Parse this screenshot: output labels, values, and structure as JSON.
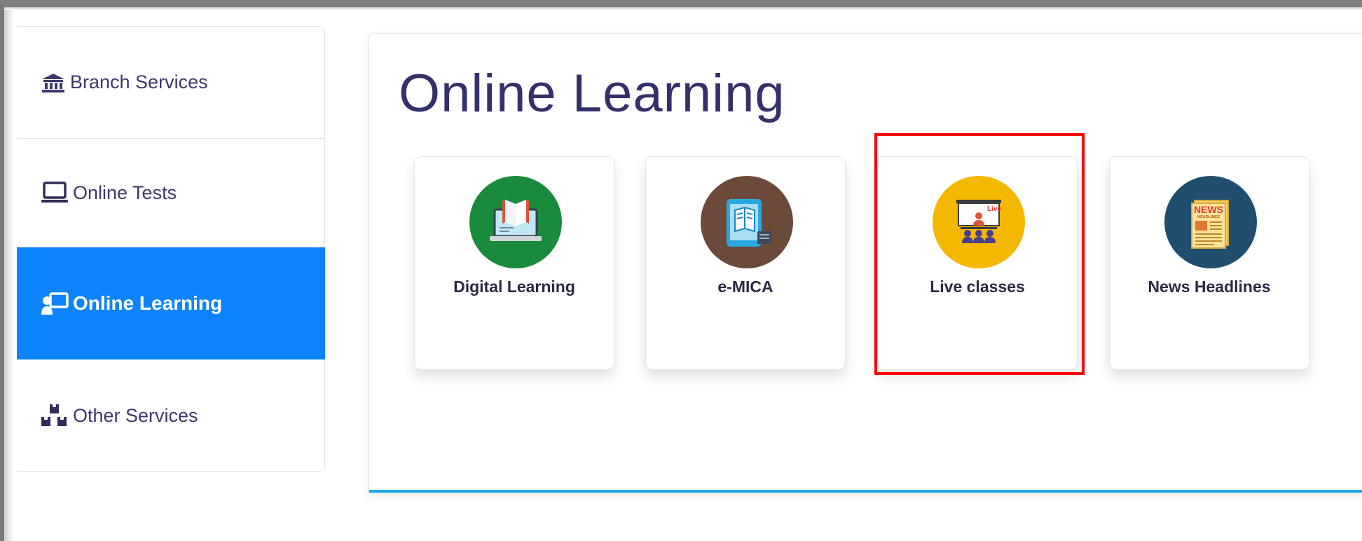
{
  "sidebar": {
    "items": [
      {
        "label": "Branch Services",
        "icon": "bank-icon",
        "active": false
      },
      {
        "label": "Online Tests",
        "icon": "laptop-icon",
        "active": false
      },
      {
        "label": "Online Learning",
        "icon": "teacher-board-icon",
        "active": true
      },
      {
        "label": "Other Services",
        "icon": "boxes-icon",
        "active": false
      }
    ]
  },
  "main": {
    "title": "Online Learning",
    "cards": [
      {
        "label": "Digital Learning",
        "icon": "laptop-book-icon",
        "color": "#1a8a3c"
      },
      {
        "label": "e-MICA",
        "icon": "tablet-book-icon",
        "color": "#6b4a3a"
      },
      {
        "label": "Live classes",
        "icon": "live-classroom-icon",
        "color": "#f5b800",
        "badge": "Live"
      },
      {
        "label": "News Headlines",
        "icon": "newspaper-icon",
        "color": "#1f4e6e",
        "paper_title": "NEWS",
        "paper_sub": "HEADLINES"
      }
    ]
  },
  "colors": {
    "accent": "#0d84fb",
    "title": "#33306b",
    "highlight": "#ff0000",
    "panel_bottom_line": "#1aa8e6"
  }
}
